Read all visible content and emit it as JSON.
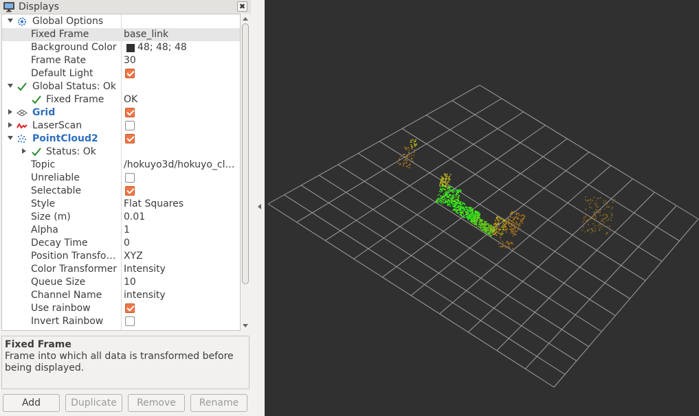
{
  "panel": {
    "title": "Displays",
    "close_label": "✖"
  },
  "tree": [
    {
      "name": "Global Options",
      "value": "",
      "kind": "header",
      "expand": "down",
      "icon": "gear-icon"
    },
    {
      "name": "Fixed Frame",
      "value": "base_link",
      "kind": "text",
      "selected": true
    },
    {
      "name": "Background Color",
      "value": "48; 48; 48",
      "kind": "color",
      "color": "#303030"
    },
    {
      "name": "Frame Rate",
      "value": "30",
      "kind": "text"
    },
    {
      "name": "Default Light",
      "value": "",
      "kind": "check",
      "checked": true
    },
    {
      "name": "Global Status: Ok",
      "value": "",
      "kind": "header",
      "expand": "down",
      "icon": "check-icon"
    },
    {
      "name": "Fixed Frame",
      "value": "OK",
      "kind": "status-sub",
      "icon": "check-icon"
    },
    {
      "name": "Grid",
      "value": "",
      "kind": "display",
      "expand": "right",
      "icon": "grid-icon",
      "checked": true,
      "blue": true
    },
    {
      "name": "LaserScan",
      "value": "",
      "kind": "display",
      "expand": "right",
      "icon": "laserscan-icon",
      "checked": false,
      "blue": false
    },
    {
      "name": "PointCloud2",
      "value": "",
      "kind": "display",
      "expand": "down",
      "icon": "pointcloud-icon",
      "checked": true,
      "blue": true
    },
    {
      "name": "Status: Ok",
      "value": "",
      "kind": "status",
      "expand": "right",
      "icon": "check-icon"
    },
    {
      "name": "Topic",
      "value": "/hokuyo3d/hokuyo_cl…",
      "kind": "text"
    },
    {
      "name": "Unreliable",
      "value": "",
      "kind": "check",
      "checked": false
    },
    {
      "name": "Selectable",
      "value": "",
      "kind": "check",
      "checked": true
    },
    {
      "name": "Style",
      "value": "Flat Squares",
      "kind": "text"
    },
    {
      "name": "Size (m)",
      "value": "0.01",
      "kind": "text"
    },
    {
      "name": "Alpha",
      "value": "1",
      "kind": "text"
    },
    {
      "name": "Decay Time",
      "value": "0",
      "kind": "text"
    },
    {
      "name": "Position Transfo…",
      "value": "XYZ",
      "kind": "text"
    },
    {
      "name": "Color Transformer",
      "value": "Intensity",
      "kind": "text"
    },
    {
      "name": "Queue Size",
      "value": "10",
      "kind": "text"
    },
    {
      "name": "Channel Name",
      "value": "intensity",
      "kind": "text"
    },
    {
      "name": "Use rainbow",
      "value": "",
      "kind": "check",
      "checked": true
    },
    {
      "name": "Invert Rainbow",
      "value": "",
      "kind": "check",
      "checked": false
    }
  ],
  "description": {
    "title": "Fixed Frame",
    "text": "Frame into which all data is transformed before being displayed."
  },
  "buttons": {
    "add": "Add",
    "duplicate": "Duplicate",
    "remove": "Remove",
    "rename": "Rename"
  },
  "viewport": {
    "background": "#303030",
    "grid_color": "#a0a0a0"
  }
}
